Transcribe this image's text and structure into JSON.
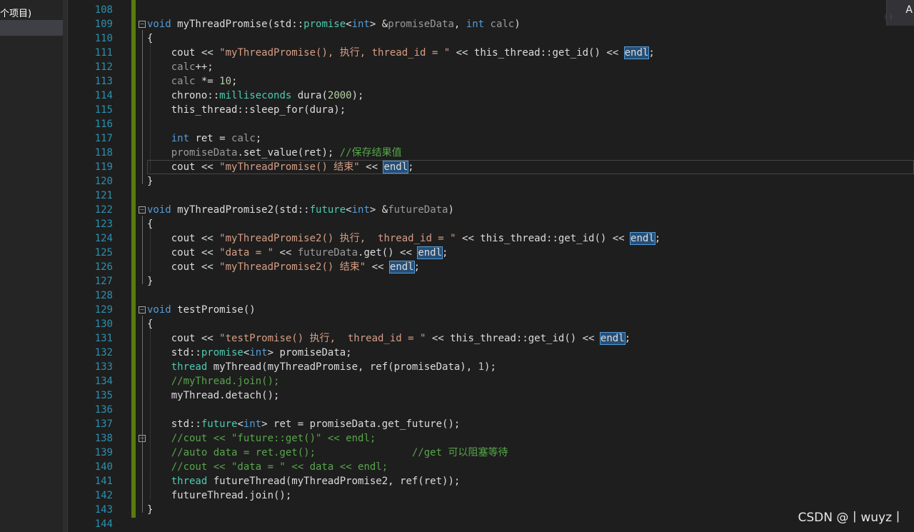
{
  "sidebar": {
    "title": "个项目)"
  },
  "topright": {
    "label": "A"
  },
  "watermark": "CSDN @丨wuyz丨",
  "colors": {
    "background": "#1e1e1e",
    "line_number": "#2b91af",
    "keyword": "#569cd6",
    "type": "#4ec9b0",
    "string": "#d69d85",
    "comment": "#57a64a",
    "change_bar": "#587c0c",
    "highlight": "#264f78"
  },
  "editor": {
    "lines": [
      {
        "num": "108",
        "tokens": [
          {
            "t": "plain",
            "v": ""
          }
        ]
      },
      {
        "num": "109",
        "fold": "−",
        "tokens": [
          {
            "t": "kw",
            "v": "void"
          },
          {
            "t": "plain",
            "v": " myThreadPromise(std::"
          },
          {
            "t": "type",
            "v": "promise"
          },
          {
            "t": "plain",
            "v": "<"
          },
          {
            "t": "kw",
            "v": "int"
          },
          {
            "t": "plain",
            "v": "> &"
          },
          {
            "t": "param",
            "v": "promiseData"
          },
          {
            "t": "plain",
            "v": ", "
          },
          {
            "t": "kw",
            "v": "int"
          },
          {
            "t": "plain",
            "v": " "
          },
          {
            "t": "param",
            "v": "calc"
          },
          {
            "t": "plain",
            "v": ")"
          }
        ]
      },
      {
        "num": "110",
        "tokens": [
          {
            "t": "plain",
            "v": "{"
          }
        ]
      },
      {
        "num": "111",
        "tokens": [
          {
            "t": "plain",
            "v": "    cout << "
          },
          {
            "t": "str",
            "v": "\"myThreadPromise(), 执行, thread_id = \""
          },
          {
            "t": "plain",
            "v": " << this_thread::get_id() << "
          },
          {
            "t": "hl",
            "v": "endl"
          },
          {
            "t": "plain",
            "v": ";"
          }
        ]
      },
      {
        "num": "112",
        "tokens": [
          {
            "t": "plain",
            "v": "    "
          },
          {
            "t": "param",
            "v": "calc"
          },
          {
            "t": "plain",
            "v": "++;"
          }
        ]
      },
      {
        "num": "113",
        "tokens": [
          {
            "t": "plain",
            "v": "    "
          },
          {
            "t": "param",
            "v": "calc"
          },
          {
            "t": "plain",
            "v": " *= "
          },
          {
            "t": "num",
            "v": "10"
          },
          {
            "t": "plain",
            "v": ";"
          }
        ]
      },
      {
        "num": "114",
        "tokens": [
          {
            "t": "plain",
            "v": "    chrono::"
          },
          {
            "t": "type",
            "v": "milliseconds"
          },
          {
            "t": "plain",
            "v": " dura("
          },
          {
            "t": "num",
            "v": "2000"
          },
          {
            "t": "plain",
            "v": ");"
          }
        ]
      },
      {
        "num": "115",
        "tokens": [
          {
            "t": "plain",
            "v": "    this_thread::sleep_for(dura);"
          }
        ]
      },
      {
        "num": "116",
        "tokens": [
          {
            "t": "plain",
            "v": ""
          }
        ]
      },
      {
        "num": "117",
        "tokens": [
          {
            "t": "plain",
            "v": "    "
          },
          {
            "t": "kw",
            "v": "int"
          },
          {
            "t": "plain",
            "v": " ret = "
          },
          {
            "t": "param",
            "v": "calc"
          },
          {
            "t": "plain",
            "v": ";"
          }
        ]
      },
      {
        "num": "118",
        "tokens": [
          {
            "t": "plain",
            "v": "    "
          },
          {
            "t": "param",
            "v": "promiseData"
          },
          {
            "t": "plain",
            "v": ".set_value(ret); "
          },
          {
            "t": "cm",
            "v": "//保存结果值"
          }
        ]
      },
      {
        "num": "119",
        "current": true,
        "tokens": [
          {
            "t": "plain",
            "v": "    cout << "
          },
          {
            "t": "str",
            "v": "\"myThreadPromise() 结束\""
          },
          {
            "t": "plain",
            "v": " << "
          },
          {
            "t": "hl",
            "v": "endl"
          },
          {
            "t": "plain",
            "v": ";"
          }
        ]
      },
      {
        "num": "120",
        "tokens": [
          {
            "t": "plain",
            "v": "}"
          }
        ]
      },
      {
        "num": "121",
        "tokens": [
          {
            "t": "plain",
            "v": ""
          }
        ]
      },
      {
        "num": "122",
        "fold": "−",
        "tokens": [
          {
            "t": "kw",
            "v": "void"
          },
          {
            "t": "plain",
            "v": " myThreadPromise2(std::"
          },
          {
            "t": "type",
            "v": "future"
          },
          {
            "t": "plain",
            "v": "<"
          },
          {
            "t": "kw",
            "v": "int"
          },
          {
            "t": "plain",
            "v": "> &"
          },
          {
            "t": "param",
            "v": "futureData"
          },
          {
            "t": "plain",
            "v": ")"
          }
        ]
      },
      {
        "num": "123",
        "tokens": [
          {
            "t": "plain",
            "v": "{"
          }
        ]
      },
      {
        "num": "124",
        "tokens": [
          {
            "t": "plain",
            "v": "    cout << "
          },
          {
            "t": "str",
            "v": "\"myThreadPromise2() 执行,  thread_id = \""
          },
          {
            "t": "plain",
            "v": " << this_thread::get_id() << "
          },
          {
            "t": "hl",
            "v": "endl"
          },
          {
            "t": "plain",
            "v": ";"
          }
        ]
      },
      {
        "num": "125",
        "tokens": [
          {
            "t": "plain",
            "v": "    cout << "
          },
          {
            "t": "str",
            "v": "\"data = \""
          },
          {
            "t": "plain",
            "v": " << "
          },
          {
            "t": "param",
            "v": "futureData"
          },
          {
            "t": "plain",
            "v": ".get() << "
          },
          {
            "t": "hl",
            "v": "endl"
          },
          {
            "t": "plain",
            "v": ";"
          }
        ]
      },
      {
        "num": "126",
        "tokens": [
          {
            "t": "plain",
            "v": "    cout << "
          },
          {
            "t": "str",
            "v": "\"myThreadPromise2() 结束\""
          },
          {
            "t": "plain",
            "v": " << "
          },
          {
            "t": "hl",
            "v": "endl"
          },
          {
            "t": "plain",
            "v": ";"
          }
        ]
      },
      {
        "num": "127",
        "tokens": [
          {
            "t": "plain",
            "v": "}"
          }
        ]
      },
      {
        "num": "128",
        "tokens": [
          {
            "t": "plain",
            "v": ""
          }
        ]
      },
      {
        "num": "129",
        "fold": "−",
        "tokens": [
          {
            "t": "kw",
            "v": "void"
          },
          {
            "t": "plain",
            "v": " testPromise()"
          }
        ]
      },
      {
        "num": "130",
        "tokens": [
          {
            "t": "plain",
            "v": "{"
          }
        ]
      },
      {
        "num": "131",
        "tokens": [
          {
            "t": "plain",
            "v": "    cout << "
          },
          {
            "t": "str",
            "v": "\"testPromise() 执行,  thread_id = \""
          },
          {
            "t": "plain",
            "v": " << this_thread::get_id() << "
          },
          {
            "t": "hl",
            "v": "endl"
          },
          {
            "t": "plain",
            "v": ";"
          }
        ]
      },
      {
        "num": "132",
        "tokens": [
          {
            "t": "plain",
            "v": "    std::"
          },
          {
            "t": "type",
            "v": "promise"
          },
          {
            "t": "plain",
            "v": "<"
          },
          {
            "t": "kw",
            "v": "int"
          },
          {
            "t": "plain",
            "v": "> promiseData;"
          }
        ]
      },
      {
        "num": "133",
        "tokens": [
          {
            "t": "plain",
            "v": "    "
          },
          {
            "t": "type",
            "v": "thread"
          },
          {
            "t": "plain",
            "v": " myThread(myThreadPromise, ref(promiseData), "
          },
          {
            "t": "num",
            "v": "1"
          },
          {
            "t": "plain",
            "v": ");"
          }
        ]
      },
      {
        "num": "134",
        "tokens": [
          {
            "t": "plain",
            "v": "    "
          },
          {
            "t": "cm",
            "v": "//myThread.join();"
          }
        ]
      },
      {
        "num": "135",
        "tokens": [
          {
            "t": "plain",
            "v": "    myThread.detach();"
          }
        ]
      },
      {
        "num": "136",
        "tokens": [
          {
            "t": "plain",
            "v": ""
          }
        ]
      },
      {
        "num": "137",
        "tokens": [
          {
            "t": "plain",
            "v": "    std::"
          },
          {
            "t": "type",
            "v": "future"
          },
          {
            "t": "plain",
            "v": "<"
          },
          {
            "t": "kw",
            "v": "int"
          },
          {
            "t": "plain",
            "v": "> ret = promiseData.get_future();"
          }
        ]
      },
      {
        "num": "138",
        "fold": "−",
        "tokens": [
          {
            "t": "plain",
            "v": "    "
          },
          {
            "t": "cm",
            "v": "//cout << \"future::get()\" << endl;"
          }
        ]
      },
      {
        "num": "139",
        "tokens": [
          {
            "t": "plain",
            "v": "    "
          },
          {
            "t": "cm",
            "v": "//auto data = ret.get();                //get 可以阻塞等待"
          }
        ]
      },
      {
        "num": "140",
        "tokens": [
          {
            "t": "plain",
            "v": "    "
          },
          {
            "t": "cm",
            "v": "//cout << \"data = \" << data << endl;"
          }
        ]
      },
      {
        "num": "141",
        "tokens": [
          {
            "t": "plain",
            "v": "    "
          },
          {
            "t": "type",
            "v": "thread"
          },
          {
            "t": "plain",
            "v": " futureThread(myThreadPromise2, ref(ret));"
          }
        ]
      },
      {
        "num": "142",
        "tokens": [
          {
            "t": "plain",
            "v": "    futureThread.join();"
          }
        ]
      },
      {
        "num": "143",
        "tokens": [
          {
            "t": "plain",
            "v": "}"
          }
        ]
      },
      {
        "num": "144",
        "tokens": [
          {
            "t": "plain",
            "v": ""
          }
        ]
      }
    ]
  }
}
